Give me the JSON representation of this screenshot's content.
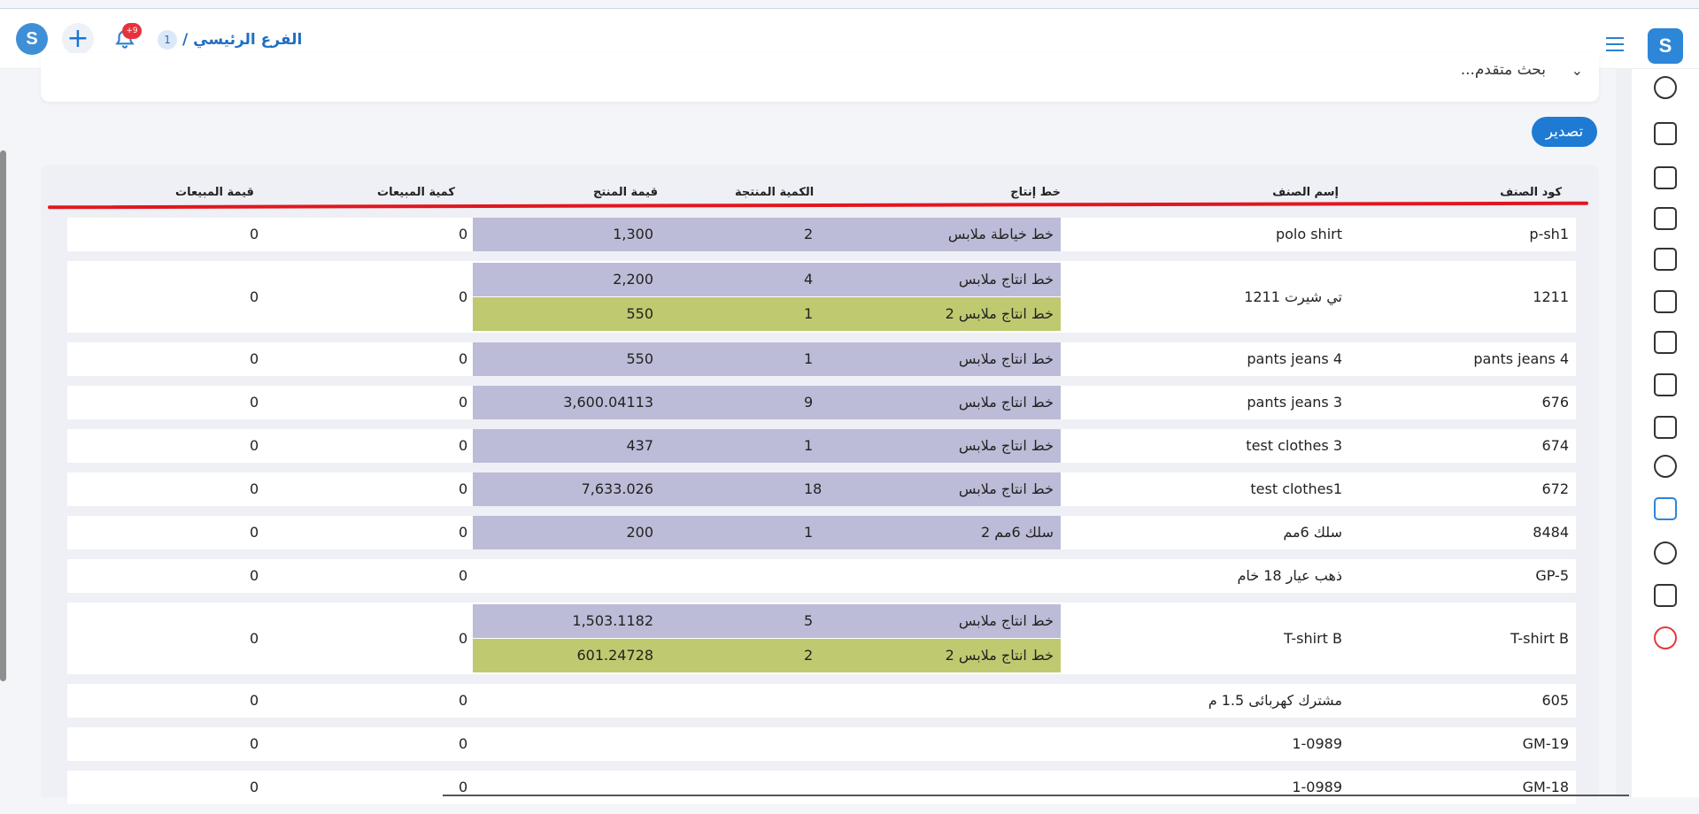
{
  "header": {
    "branch_number": "1",
    "branch_name": "الفرع الرئيسي /",
    "notification_count": "+9"
  },
  "search": {
    "advanced_label": "بحث متقدم..."
  },
  "export_label": "تصدير",
  "table": {
    "headers": {
      "code": "كود الصنف",
      "name": "إسم الصنف",
      "line": "خط إنتاج",
      "produced_qty": "الكمية المنتجة",
      "product_value": "قيمة المنتج",
      "sales_qty": "كمية المبيعات",
      "sales_value": "قيمة المبيعات"
    },
    "rows": [
      {
        "code": "p-sh1",
        "name": "polo shirt",
        "sales_qty": "0",
        "sales_value": "0",
        "lines": [
          {
            "line": "خط خياطة ملابس",
            "qty": "2",
            "value": "1,300",
            "color": "blue"
          }
        ]
      },
      {
        "code": "1211",
        "name": "تي شيرت 1211",
        "sales_qty": "0",
        "sales_value": "0",
        "lines": [
          {
            "line": "خط انتاج ملابس",
            "qty": "4",
            "value": "2,200",
            "color": "blue"
          },
          {
            "line": "خط انتاج ملابس 2",
            "qty": "1",
            "value": "550",
            "color": "green"
          }
        ]
      },
      {
        "code": "pants jeans 4",
        "name": "pants jeans 4",
        "sales_qty": "0",
        "sales_value": "0",
        "lines": [
          {
            "line": "خط انتاج ملابس",
            "qty": "1",
            "value": "550",
            "color": "blue"
          }
        ]
      },
      {
        "code": "676",
        "name": "pants jeans 3",
        "sales_qty": "0",
        "sales_value": "0",
        "lines": [
          {
            "line": "خط انتاج ملابس",
            "qty": "9",
            "value": "3,600.04113",
            "color": "blue"
          }
        ]
      },
      {
        "code": "674",
        "name": "test clothes 3",
        "sales_qty": "0",
        "sales_value": "0",
        "lines": [
          {
            "line": "خط انتاج ملابس",
            "qty": "1",
            "value": "437",
            "color": "blue"
          }
        ]
      },
      {
        "code": "672",
        "name": "test clothes1",
        "sales_qty": "0",
        "sales_value": "0",
        "lines": [
          {
            "line": "خط انتاج ملابس",
            "qty": "18",
            "value": "7,633.026",
            "color": "blue"
          }
        ]
      },
      {
        "code": "8484",
        "name": "سلك 6مم",
        "sales_qty": "0",
        "sales_value": "0",
        "lines": [
          {
            "line": "سلك 6مم 2",
            "qty": "1",
            "value": "200",
            "color": "blue"
          }
        ]
      },
      {
        "code": "GP-5",
        "name": "ذهب عيار 18 خام",
        "sales_qty": "0",
        "sales_value": "0",
        "lines": []
      },
      {
        "code": "T-shirt B",
        "name": "T-shirt B",
        "sales_qty": "0",
        "sales_value": "0",
        "lines": [
          {
            "line": "خط انتاج ملابس",
            "qty": "5",
            "value": "1,503.1182",
            "color": "blue"
          },
          {
            "line": "خط انتاج ملابس 2",
            "qty": "2",
            "value": "601.24728",
            "color": "green"
          }
        ]
      },
      {
        "code": "605",
        "name": "مشترك كهربائى 1.5 م",
        "sales_qty": "0",
        "sales_value": "0",
        "lines": []
      },
      {
        "code": "GM-19",
        "name": "1-0989",
        "sales_qty": "0",
        "sales_value": "0",
        "lines": []
      },
      {
        "code": "GM-18",
        "name": "1-0989",
        "sales_qty": "0",
        "sales_value": "0",
        "lines": []
      }
    ]
  },
  "sidebar_icons": [
    "dashboard-icon",
    "store-icon",
    "inventory-icon",
    "columns-icon",
    "document-money-icon",
    "document-icon",
    "box-document-icon",
    "document-check-icon",
    "transfer-icon",
    "refresh-icon",
    "layout-icon",
    "gear-icon",
    "screen-icon",
    "power-icon"
  ]
}
